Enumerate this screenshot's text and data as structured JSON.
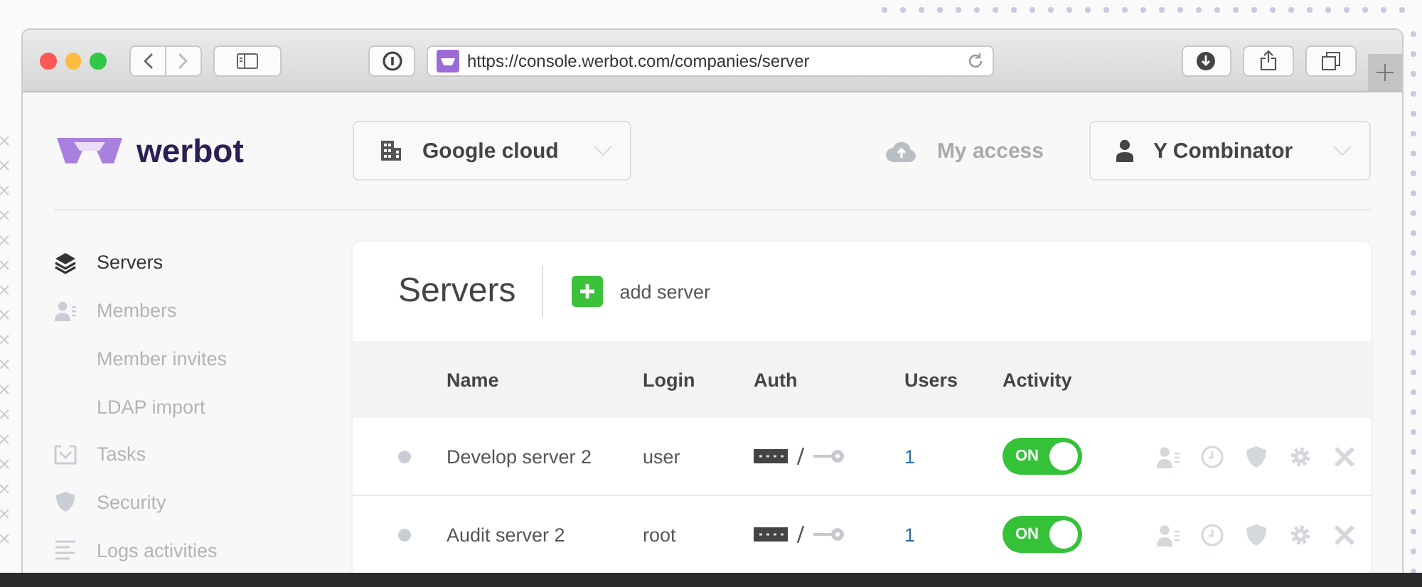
{
  "browser": {
    "url": "https://console.werbot.com/companies/server"
  },
  "header": {
    "logo": "werbot",
    "company": "Google cloud",
    "access": "My access",
    "account": "Y Combinator"
  },
  "sidebar": {
    "items": [
      {
        "label": "Servers",
        "selected": true
      },
      {
        "label": "Members",
        "selected": false,
        "children": [
          {
            "label": "Member invites",
            "selected": false
          },
          {
            "label": "LDAP import",
            "selected": false
          }
        ]
      },
      {
        "label": "Tasks",
        "selected": false
      },
      {
        "label": "Security",
        "selected": false
      },
      {
        "label": "Logs activities",
        "selected": false
      }
    ]
  },
  "page": {
    "title": "Servers",
    "add_label": "add server"
  },
  "table": {
    "columns": [
      "Name",
      "Login",
      "Auth",
      "Users",
      "Activity"
    ],
    "rows": [
      {
        "name": "Develop server 2",
        "login": "user",
        "users": "1",
        "activity": {
          "on": true,
          "label": "ON"
        }
      },
      {
        "name": "Audit server 2",
        "login": "root",
        "users": "1",
        "activity": {
          "on": true,
          "label": "ON"
        }
      }
    ]
  }
}
